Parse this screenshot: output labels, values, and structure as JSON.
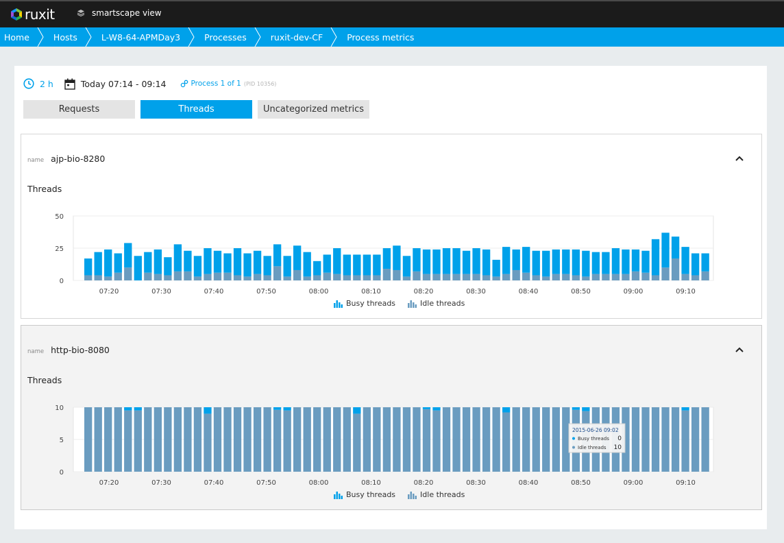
{
  "app": {
    "logo_text": "ruxit",
    "smartscape_label": "smartscape view"
  },
  "breadcrumb": [
    "Home",
    "Hosts",
    "L-W8-64-APMDay3",
    "Processes",
    "ruxit-dev-CF",
    "Process metrics"
  ],
  "timeframe": {
    "duration": "2 h",
    "range": "Today 07:14 - 09:14",
    "process": "Process 1 of 1",
    "pid": "(PID 10356)"
  },
  "tabs": [
    {
      "label": "Requests",
      "active": false
    },
    {
      "label": "Threads",
      "active": true
    },
    {
      "label": "Uncategorized metrics",
      "active": false
    }
  ],
  "colors": {
    "accent": "#00a1ea",
    "busy": "#00a1ea",
    "idle": "#6a9cc0",
    "topbar": "#1b1b1b"
  },
  "legend": {
    "busy": "Busy threads",
    "idle": "Idle threads"
  },
  "cards": [
    {
      "name_label": "name",
      "name": "ajp-bio-8280",
      "subtitle": "Threads"
    },
    {
      "name_label": "name",
      "name": "http-bio-8080",
      "subtitle": "Threads"
    }
  ],
  "chart_data": [
    {
      "type": "bar",
      "title": "Threads",
      "stacked": true,
      "x_ticks": [
        "07:20",
        "07:30",
        "07:40",
        "07:50",
        "08:00",
        "08:10",
        "08:20",
        "08:30",
        "08:40",
        "08:50",
        "09:00",
        "09:10"
      ],
      "y_ticks": [
        0,
        25,
        50
      ],
      "ylim": [
        0,
        50
      ],
      "series": [
        {
          "name": "Busy threads",
          "values": [
            13,
            18,
            21,
            15,
            19,
            19,
            16,
            19,
            14,
            21,
            16,
            16,
            20,
            17,
            15,
            21,
            18,
            18,
            15,
            17,
            16,
            19,
            19,
            11,
            14,
            20,
            16,
            16,
            16,
            16,
            16,
            19,
            16,
            18,
            19,
            19,
            20,
            20,
            18,
            20,
            20,
            13,
            21,
            16,
            20,
            19,
            20,
            19,
            19,
            20,
            20,
            17,
            17,
            20,
            19,
            17,
            17,
            28,
            27,
            17,
            21,
            17,
            14
          ]
        },
        {
          "name": "Idle threads",
          "values": [
            4,
            4,
            3,
            6,
            10,
            0,
            6,
            5,
            4,
            7,
            7,
            3,
            5,
            6,
            6,
            4,
            3,
            5,
            4,
            11,
            3,
            8,
            3,
            4,
            6,
            5,
            4,
            4,
            4,
            4,
            9,
            8,
            3,
            7,
            5,
            5,
            5,
            5,
            5,
            5,
            4,
            3,
            5,
            8,
            6,
            4,
            3,
            5,
            5,
            4,
            3,
            5,
            5,
            5,
            5,
            7,
            6,
            4,
            10,
            17,
            5,
            4,
            7
          ]
        }
      ]
    },
    {
      "type": "bar",
      "title": "Threads",
      "stacked": true,
      "x_ticks": [
        "07:20",
        "07:30",
        "07:40",
        "07:50",
        "08:00",
        "08:10",
        "08:20",
        "08:30",
        "08:40",
        "08:50",
        "09:00",
        "09:10"
      ],
      "y_ticks": [
        0,
        5,
        10
      ],
      "ylim": [
        0,
        10
      ],
      "series": [
        {
          "name": "Busy threads",
          "values": [
            0,
            0,
            0,
            0,
            0.5,
            0.5,
            0,
            0,
            0,
            0,
            0,
            0,
            1,
            0,
            0,
            0,
            0,
            0,
            0,
            0.4,
            0.5,
            0,
            0,
            0,
            0,
            0,
            0,
            1,
            0,
            0,
            0,
            0,
            0,
            0,
            0.3,
            0.5,
            0,
            0,
            0,
            0,
            0,
            0,
            0.8,
            0,
            0,
            0,
            0,
            0,
            0,
            0.4,
            0.6,
            0,
            0,
            0,
            0,
            0,
            0,
            0,
            0,
            0,
            0.5,
            0,
            0
          ]
        },
        {
          "name": "Idle threads",
          "values": [
            10,
            10,
            10,
            10,
            9.5,
            9.5,
            10,
            10,
            10,
            10,
            10,
            10,
            9,
            10,
            10,
            10,
            10,
            10,
            10,
            9.6,
            9.5,
            10,
            10,
            10,
            10,
            10,
            10,
            9,
            10,
            10,
            10,
            10,
            10,
            10,
            9.7,
            9.5,
            10,
            10,
            10,
            10,
            10,
            10,
            9.2,
            10,
            10,
            10,
            10,
            10,
            10,
            9.6,
            9.4,
            10,
            10,
            10,
            10,
            10,
            10,
            10,
            10,
            10,
            9.5,
            10,
            10
          ]
        }
      ],
      "tooltip": {
        "date": "2015-06-26 09:02",
        "rows": [
          {
            "label": "Busy threads",
            "value": "0"
          },
          {
            "label": "Idle threads",
            "value": "10"
          }
        ]
      }
    }
  ]
}
